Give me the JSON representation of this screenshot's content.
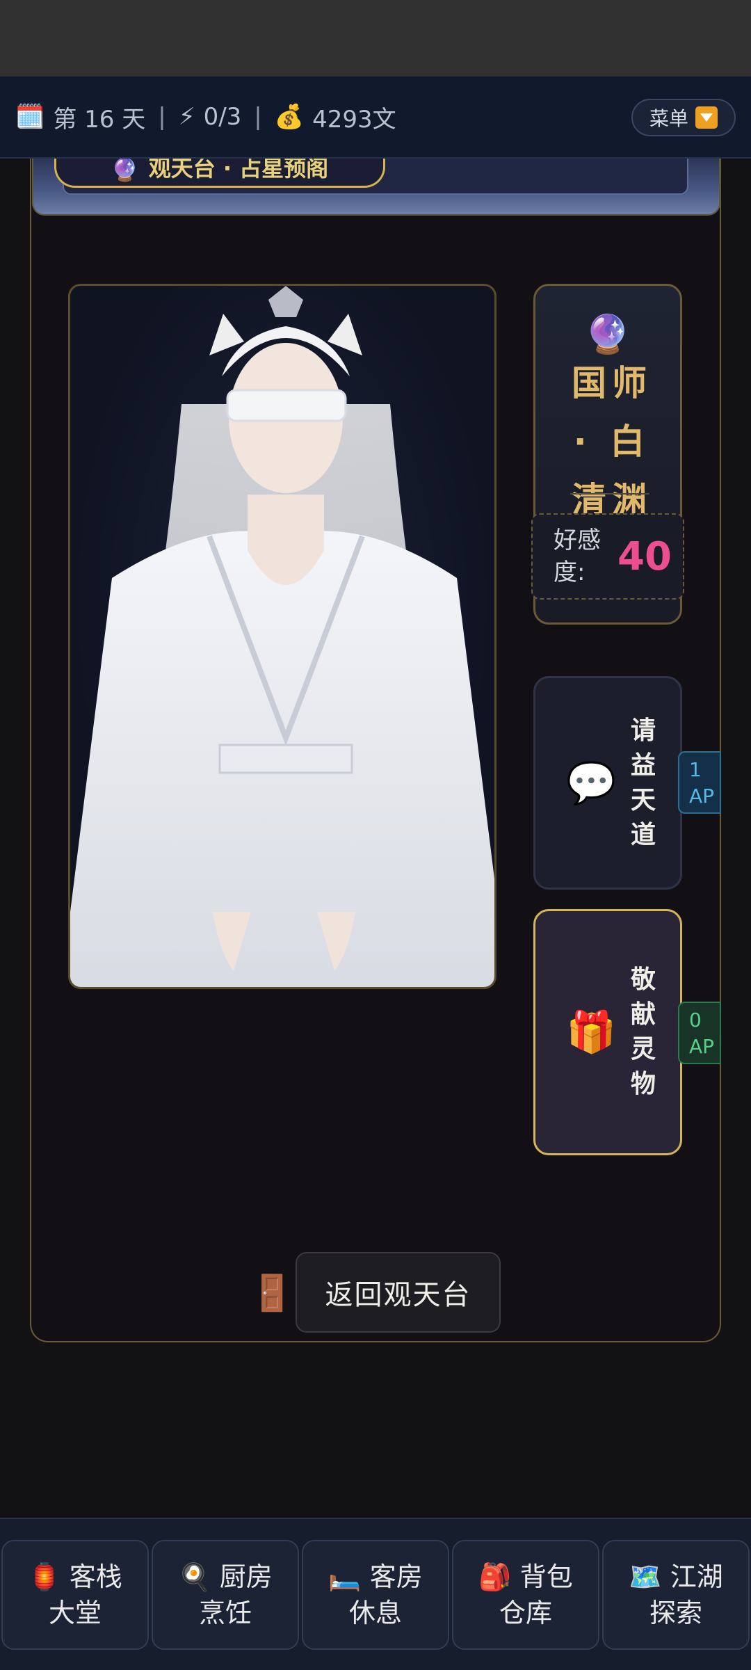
{
  "status": {
    "calendar_icon": "🗓️",
    "day_text": "第 16 天",
    "energy_icon": "⚡",
    "energy_text": "0/3",
    "money_icon": "💰",
    "money_text": "4293文",
    "separator": "|"
  },
  "menu": {
    "label": "菜单"
  },
  "location": {
    "icon": "🔮",
    "title": "观天台 · 占星预阁"
  },
  "character": {
    "orb_icon": "🔮",
    "name": "国师 · 白清渊",
    "favor_label": "好感度:",
    "favor_value": "40"
  },
  "actions": [
    {
      "icon": "💬",
      "label": "请益天道",
      "ap": "1 AP"
    },
    {
      "icon": "🎁",
      "label": "敬献灵物",
      "ap": "0 AP"
    }
  ],
  "back": {
    "icon": "🚪",
    "label": "返回观天台"
  },
  "nav": [
    {
      "icon": "🏮",
      "label": "客栈大堂"
    },
    {
      "icon": "🍳",
      "label": "厨房烹饪"
    },
    {
      "icon": "🛏️",
      "label": "客房休息"
    },
    {
      "icon": "🎒",
      "label": "背包仓库"
    },
    {
      "icon": "🗺️",
      "label": "江湖探索"
    }
  ],
  "colors": {
    "accent_gold": "#d8b250",
    "favor_pink": "#ec4e8f",
    "ap_blue": "#58b8e8",
    "ap_green": "#57d08c"
  }
}
